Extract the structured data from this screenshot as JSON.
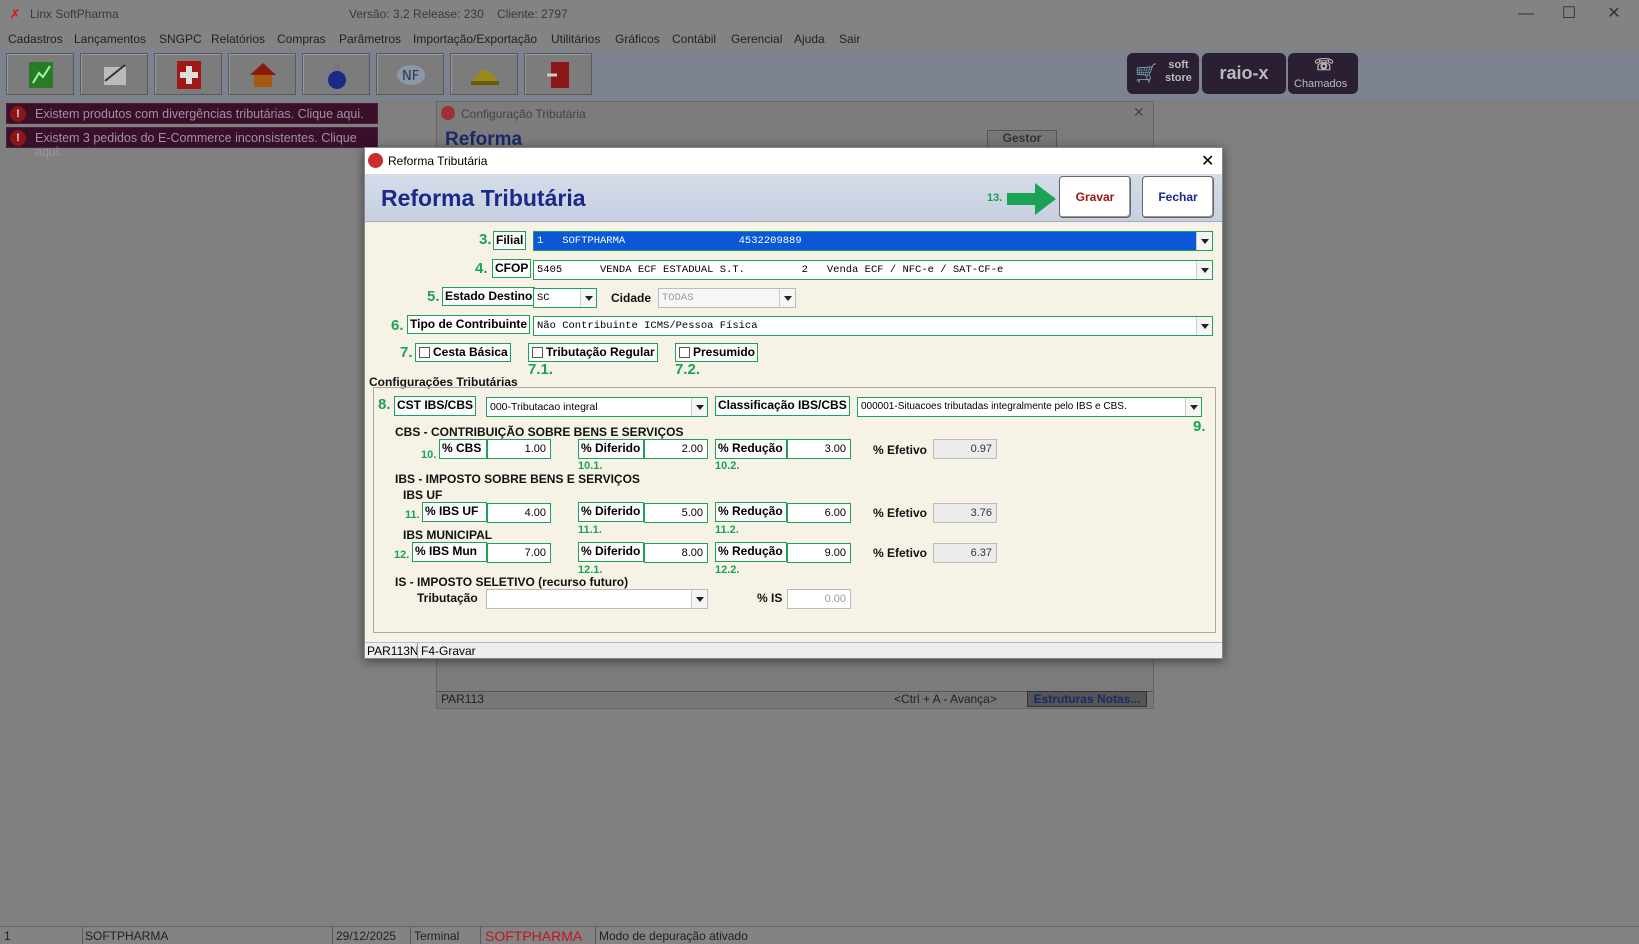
{
  "app": {
    "title": "Linx SoftPharma",
    "version": "Versão: 3.2 Release: 230",
    "client": "Cliente: 2797"
  },
  "menu": [
    "Cadastros",
    "Lançamentos",
    "SNGPC",
    "Relatórios",
    "Compras",
    "Parâmetros",
    "Importação/Exportação",
    "Utilitários",
    "Gráficos",
    "Contábil",
    "Gerencial",
    "Ajuda",
    "Sair"
  ],
  "toolbar_right": {
    "soft_store": "soft\nstore",
    "raio_x": "raio-x",
    "chamados": "Chamados"
  },
  "alerts": [
    "Existem produtos com divergências tributárias. Clique aqui.",
    "Existem 3 pedidos do E-Commerce inconsistentes. Clique aqui."
  ],
  "bgwin": {
    "title": "Configuração Tributária",
    "heading": "Reforma",
    "gestor": "Gestor",
    "par": "PAR113",
    "hint": "<Ctrl + A - Avança>",
    "estruturas": "Estruturas Notas..."
  },
  "dialog": {
    "title": "Reforma Tributária",
    "heading": "Reforma Tributária",
    "gravar": "Gravar",
    "fechar": "Fechar",
    "arrow_num": "13.",
    "filial": {
      "num": "3.",
      "label": "Filial",
      "value": "1   SOFTPHARMA                  4532209889"
    },
    "cfop": {
      "num": "4.",
      "label": "CFOP",
      "value": "5405      VENDA ECF ESTADUAL S.T.         2   Venda ECF / NFC-e / SAT-CF-e"
    },
    "estado": {
      "num": "5.",
      "label": "Estado Destino",
      "value": "SC"
    },
    "cidade": {
      "label": "Cidade",
      "value": "TODAS"
    },
    "contrib": {
      "num": "6.",
      "label": "Tipo de Contribuinte",
      "value": "Não Contribuinte ICMS/Pessoa Física"
    },
    "cesta": {
      "num": "7.",
      "label": "Cesta Básica"
    },
    "regular": {
      "num": "7.1.",
      "label": "Tributação Regular"
    },
    "presumido": {
      "num": "7.2.",
      "label": "Presumido"
    },
    "group_label": "Configurações Tributárias",
    "cst": {
      "num": "8.",
      "label": "CST IBS/CBS",
      "value": "000-Tributacao integral"
    },
    "classif": {
      "num": "9.",
      "label": "Classificação IBS/CBS",
      "value": "000001-Situacoes tributadas integralmente pelo IBS e CBS."
    },
    "cbs_title": "CBS - CONTRIBUIÇÃO SOBRE BENS E SERVIÇOS",
    "cbs": {
      "num": "10.",
      "label": "% CBS",
      "value": "1.00",
      "dif_num": "10.1.",
      "dif_label": "% Diferido",
      "dif": "2.00",
      "red_num": "10.2.",
      "red_label": "% Redução",
      "red": "3.00",
      "ef_label": "% Efetivo",
      "ef": "0.97"
    },
    "ibs_title": "IBS - IMPOSTO SOBRE BENS E SERVIÇOS",
    "ibsuf_title": "IBS UF",
    "ibsuf": {
      "num": "11.",
      "label": "% IBS UF",
      "value": "4.00",
      "dif_num": "11.1.",
      "dif_label": "% Diferido",
      "dif": "5.00",
      "red_num": "11.2.",
      "red_label": "% Redução",
      "red": "6.00",
      "ef_label": "% Efetivo",
      "ef": "3.76"
    },
    "ibsmun_title": "IBS MUNICIPAL",
    "ibsmun": {
      "num": "12.",
      "label": "% IBS Mun",
      "value": "7.00",
      "dif_num": "12.1.",
      "dif_label": "% Diferido",
      "dif": "8.00",
      "red_num": "12.2.",
      "red_label": "% Redução",
      "red": "9.00",
      "ef_label": "% Efetivo",
      "ef": "6.37"
    },
    "is_title": "IS - IMPOSTO SELETIVO (recurso futuro)",
    "is": {
      "trib_label": "Tributação",
      "trib": "",
      "label": "% IS",
      "value": "0.00"
    },
    "footer": {
      "code": "PAR113N",
      "hint": "F4-Gravar"
    }
  },
  "status": {
    "n": "1",
    "company": "SOFTPHARMA",
    "date": "29/12/2025",
    "terminal": "Terminal",
    "brand": "SOFTPHARMA",
    "mode": "Modo de depuração ativado"
  },
  "colors": {
    "accent_green": "#1aa356",
    "heading_blue": "#1a2a8a",
    "brand_red": "#d0202a"
  }
}
